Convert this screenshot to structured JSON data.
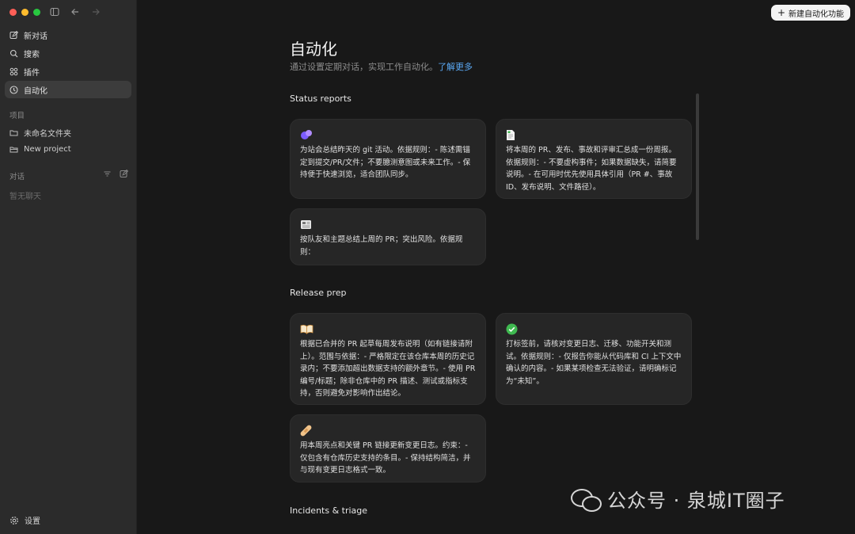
{
  "sidebar": {
    "nav": [
      {
        "label": "新对话",
        "icon": "edit-icon"
      },
      {
        "label": "搜索",
        "icon": "search-icon"
      },
      {
        "label": "插件",
        "icon": "grid-icon"
      },
      {
        "label": "自动化",
        "icon": "clock-icon"
      }
    ],
    "projects_label": "项目",
    "projects": [
      {
        "label": "未命名文件夹",
        "icon": "folder-icon"
      },
      {
        "label": "New project",
        "icon": "folder-plus-icon"
      }
    ],
    "chats_label": "对话",
    "empty_chats": "暂无聊天",
    "settings_label": "设置"
  },
  "header": {
    "new_button": "新建自动化功能"
  },
  "main": {
    "title": "自动化",
    "subtitle": "通过设置定期对话，实现工作自动化。",
    "learn_more": "了解更多",
    "groups": [
      {
        "title": "Status reports",
        "cards": [
          {
            "emoji": "🟣",
            "text": "为站会总结昨天的 git 活动。依据规则：- 陈述需锚定到提交/PR/文件；不要臆测意图或未来工作。- 保持便于快速浏览，适合团队同步。"
          },
          {
            "emoji": "📄",
            "text": "将本周的 PR、发布、事故和评审汇总成一份周报。依据规则：- 不要虚构事件；如果数据缺失，请简要说明。- 在可用时优先使用具体引用（PR #、事故 ID、发布说明、文件路径）。"
          },
          {
            "emoji": "📰",
            "text": "按队友和主题总结上周的 PR；突出风险。依据规则："
          }
        ]
      },
      {
        "title": "Release prep",
        "cards": [
          {
            "emoji": "📖",
            "text": "根据已合并的 PR 起草每周发布说明（如有链接请附上）。范围与依据：- 严格限定在该仓库本周的历史记录内；不要添加超出数据支持的额外章节。- 使用 PR 编号/标题；除非仓库中的 PR 描述、测试或指标支持，否则避免对影响作出结论。"
          },
          {
            "emoji": "✅",
            "text": "打标签前，请核对变更日志、迁移、功能开关和测试。依据规则：- 仅报告你能从代码库和 CI 上下文中确认的内容。- 如果某项检查无法验证，请明确标记为“未知”。"
          },
          {
            "emoji": "🩹",
            "text": "用本周亮点和关键 PR 链接更新变更日志。约束：- 仅包含有仓库历史支持的条目。- 保持结构简洁，并与现有变更日志格式一致。"
          }
        ]
      },
      {
        "title": "Incidents & triage"
      }
    ]
  },
  "watermark": {
    "text": "公众号 · 泉城IT圈子"
  }
}
